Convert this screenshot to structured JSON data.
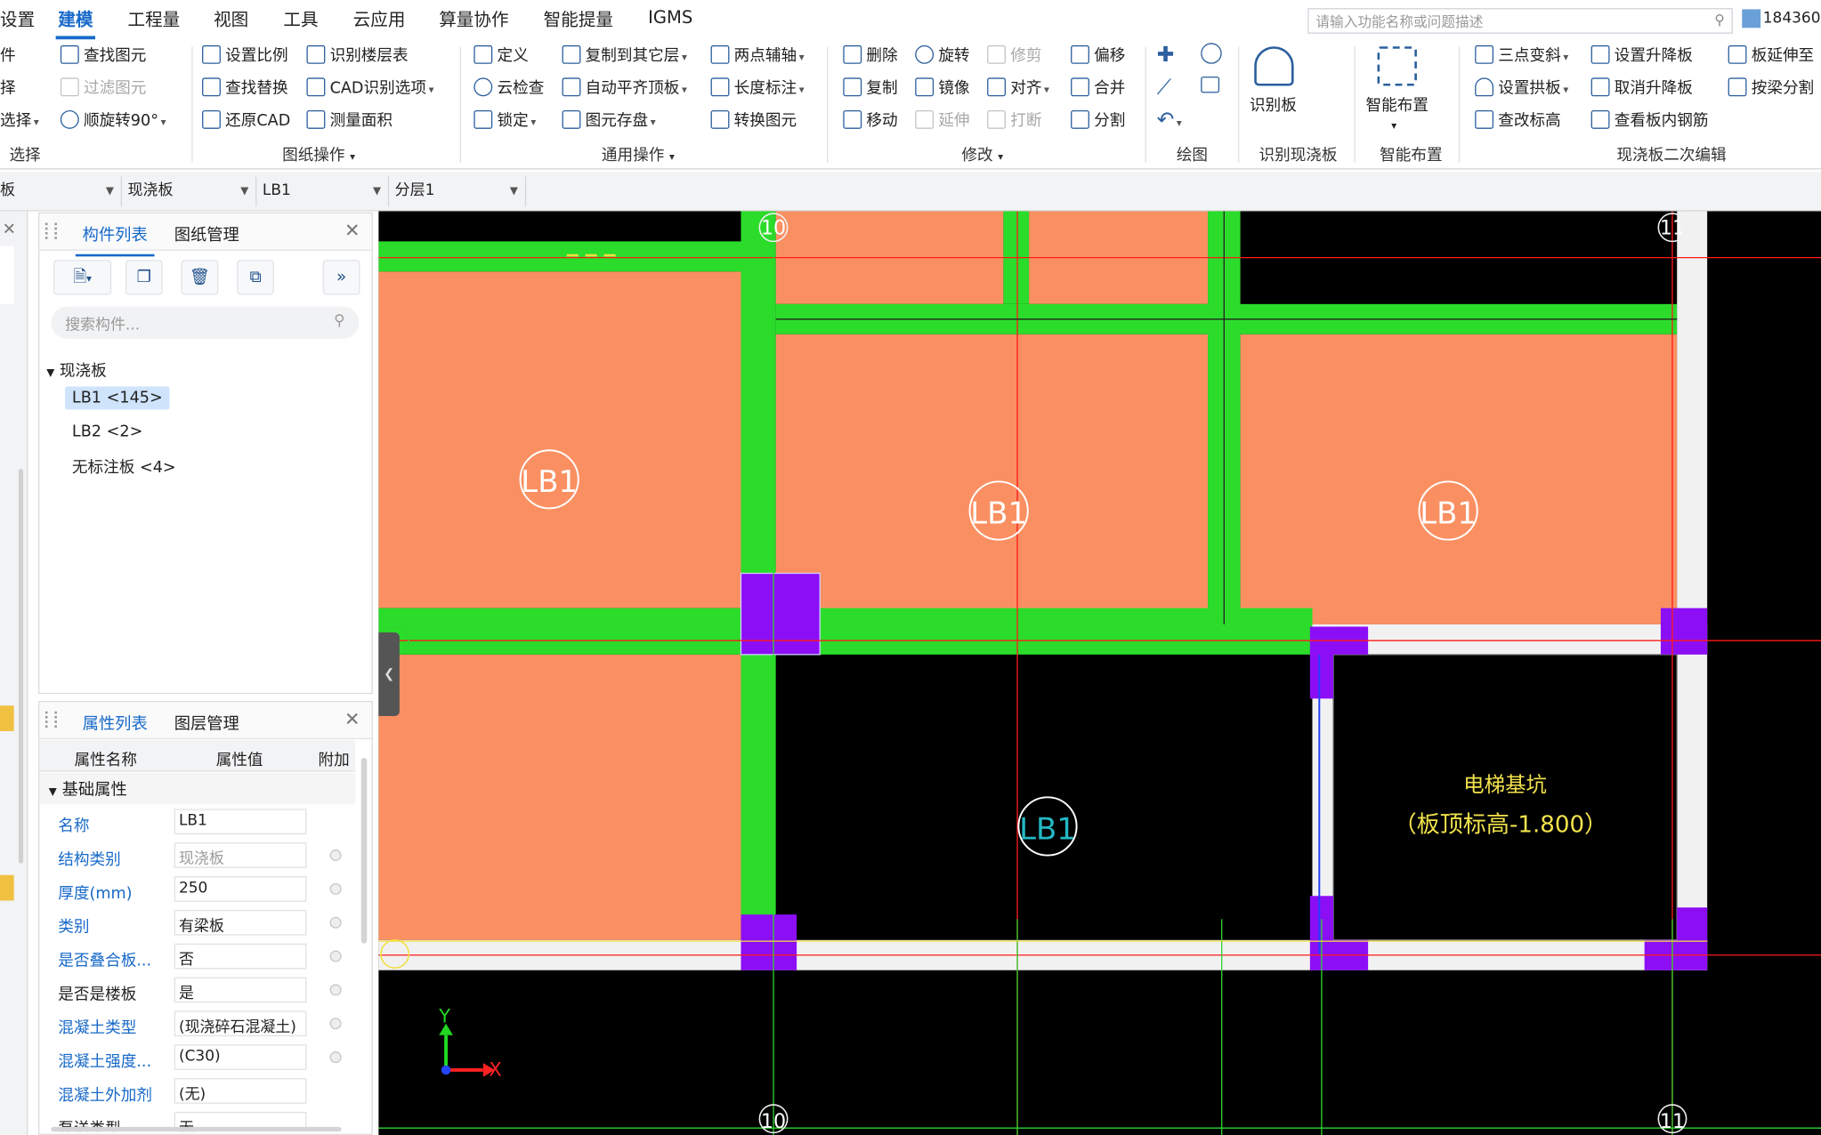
{
  "menu": {
    "items": [
      {
        "label": "设置"
      },
      {
        "label": "建模"
      },
      {
        "label": "工程量"
      },
      {
        "label": "视图"
      },
      {
        "label": "工具"
      },
      {
        "label": "云应用"
      },
      {
        "label": "算量协作"
      },
      {
        "label": "智能提量"
      },
      {
        "label": "IGMS"
      }
    ],
    "active": "建模",
    "search_placeholder": "请输入功能名称或问题描述",
    "user": "184360"
  },
  "ribbon": {
    "select": {
      "items": [
        "件",
        "择",
        "选择",
        "查找图元",
        "过滤图元",
        "顺旋转90°"
      ],
      "group": "选择"
    },
    "drawing": {
      "items": [
        "设置比例",
        "识别楼层表",
        "查找替换",
        "CAD识别选项",
        "还原CAD",
        "测量面积"
      ],
      "group": "图纸操作"
    },
    "general": {
      "items": [
        "定义",
        "复制到其它层",
        "两点辅轴",
        "云检查",
        "自动平齐顶板",
        "长度标注",
        "锁定",
        "图元存盘",
        "转换图元"
      ],
      "group": "通用操作"
    },
    "modify": {
      "items": [
        "删除",
        "旋转",
        "修剪",
        "偏移",
        "复制",
        "镜像",
        "对齐",
        "合并",
        "移动",
        "延伸",
        "打断",
        "分割"
      ],
      "group": "修改"
    },
    "draw": {
      "group": "绘图"
    },
    "recognize": {
      "label": "识别板",
      "group": "识别现浇板"
    },
    "smart": {
      "label": "智能布置",
      "group": "智能布置"
    },
    "secondary": {
      "items": [
        "三点变斜",
        "设置升降板",
        "板延伸至",
        "设置拱板",
        "取消升降板",
        "按梁分割",
        "查改标高",
        "查看板内钢筋"
      ],
      "group": "现浇板二次编辑"
    }
  },
  "filterbar": {
    "combo1": "板",
    "combo2": "现浇板",
    "combo3": "LB1",
    "combo4": "分层1"
  },
  "component_panel": {
    "tabs": [
      "构件列表",
      "图纸管理"
    ],
    "search_placeholder": "搜索构件...",
    "tree": {
      "root": "现浇板",
      "items": [
        "LB1 <145>",
        "LB2 <2>",
        "无标注板 <4>"
      ],
      "selected": "LB1 <145>"
    }
  },
  "property_panel": {
    "tabs": [
      "属性列表",
      "图层管理"
    ],
    "headers": [
      "属性名称",
      "属性值",
      "附加"
    ],
    "section": "基础属性",
    "rows": [
      {
        "name": "名称",
        "value": "LB1"
      },
      {
        "name": "结构类别",
        "value": "现浇板"
      },
      {
        "name": "厚度(mm)",
        "value": "250"
      },
      {
        "name": "类别",
        "value": "有梁板"
      },
      {
        "name": "是否叠合板...",
        "value": "否"
      },
      {
        "name": "是否是楼板",
        "value": "是"
      },
      {
        "name": "混凝土类型",
        "value": "(现浇碎石混凝土)"
      },
      {
        "name": "混凝土强度...",
        "value": "(C30)"
      },
      {
        "name": "混凝土外加剂",
        "value": "(无)"
      },
      {
        "name": "泵送类型",
        "value": "无"
      }
    ]
  },
  "canvas": {
    "axis_labels": [
      "10",
      "11",
      "10",
      "11"
    ],
    "slab_label": "LB1",
    "annotation_line1": "电梯基坑",
    "annotation_line2": "（板顶标高-1.800）",
    "ucs_x": "X",
    "ucs_y": "Y",
    "colors": {
      "slab": "#fa9062",
      "beam": "#2bdc2b",
      "column": "#8c0ef5",
      "grid_red": "#ff1a1a",
      "grid_green": "#2ed52e",
      "background": "#000000",
      "wall": "#f1f1f1"
    }
  }
}
